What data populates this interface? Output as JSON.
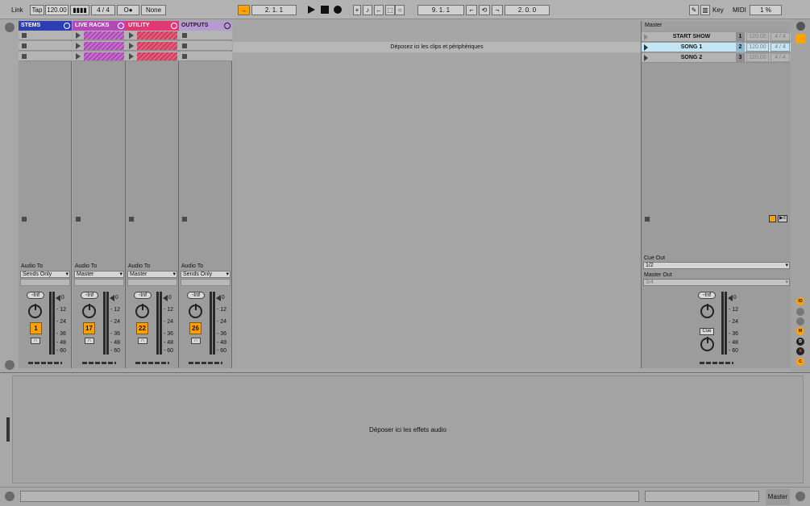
{
  "transport": {
    "link": "Link",
    "tap": "Tap",
    "tempo": "120.00",
    "signature": "4 / 4",
    "record_mode": "O●",
    "quantize": "None",
    "position": "2.  1.  1",
    "loop_start": "9.  1.  1",
    "loop_length": "2.  0.  0",
    "key": "Key",
    "midi": "MIDI",
    "cpu": "1 %"
  },
  "tracks": [
    {
      "name": "STEMS",
      "color": "#2c3fb5",
      "audio_to_label": "Audio To",
      "audio_to": "Sends Only",
      "volume": "-Inf",
      "number": "1",
      "clips": [
        "stop",
        "stop",
        "stop"
      ]
    },
    {
      "name": "LIVE RACKS",
      "color": "#b548b9",
      "audio_to_label": "Audio To",
      "audio_to": "Master",
      "volume": "-Inf",
      "number": "17",
      "clips": [
        "clip",
        "clip",
        "clip"
      ]
    },
    {
      "name": "UTILITY",
      "color": "#e03872",
      "audio_to_label": "Audio To",
      "audio_to": "Master",
      "volume": "-Inf",
      "number": "22",
      "clips": [
        "clip",
        "clip",
        "clip"
      ]
    },
    {
      "name": "OUTPUTS",
      "color": "#b89ad2",
      "audio_to_label": "Audio To",
      "audio_to": "Sends Only",
      "volume": "-Inf",
      "number": "26",
      "clips": [
        "stop",
        "stop",
        "stop"
      ]
    }
  ],
  "meter_scale": [
    "0",
    "12",
    "24",
    "36",
    "48",
    "60"
  ],
  "session_drop_text": "Déposez ici les clips et périphériques",
  "master": {
    "title": "Master",
    "scenes": [
      {
        "name": "START SHOW",
        "number": "1",
        "tempo": "120.00",
        "signature": "4 / 4"
      },
      {
        "name": "SONG 1",
        "number": "2",
        "tempo": "120.00",
        "signature": "4 / 4"
      },
      {
        "name": "SONG 2",
        "number": "3",
        "tempo": "120.00",
        "signature": "4 / 4"
      }
    ],
    "cue_out_label": "Cue Out",
    "cue_out": "1/2",
    "master_out_label": "Master Out",
    "master_out": "3/4",
    "volume": "-Inf",
    "cue": "Cue"
  },
  "device_drop_text": "Déposer ici les effets audio",
  "status_master": "Master",
  "colors": {
    "accent": "#ffa200",
    "selected_scene": "#c4e5f4"
  }
}
